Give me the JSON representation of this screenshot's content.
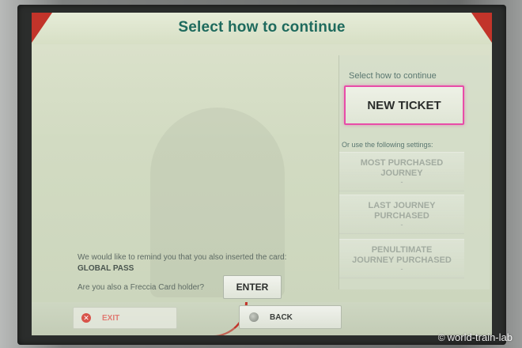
{
  "header": {
    "title": "Select how to continue"
  },
  "panel": {
    "heading": "Select how to continue",
    "new_ticket_label": "NEW TICKET",
    "subheading": "Or use the following settings:",
    "options": [
      {
        "line1": "MOST PURCHASED",
        "line2": "JOURNEY",
        "dot": "-"
      },
      {
        "line1": "LAST JOURNEY",
        "line2": "PURCHASED",
        "dot": "-"
      },
      {
        "line1": "PENULTIMATE",
        "line2": "JOURNEY PURCHASED",
        "dot": "-"
      }
    ]
  },
  "reminder": {
    "text": "We would like to remind you that you also inserted the card:",
    "card_name": "GLOBAL PASS",
    "question": "Are you also a Freccia Card holder?",
    "enter_label": "ENTER"
  },
  "bottom": {
    "exit_label": "EXIT",
    "back_label": "BACK"
  },
  "watermark": {
    "icon": "©",
    "text": "world-train-lab"
  },
  "colors": {
    "title": "#1e6a5d",
    "accent_red": "#c2342a",
    "highlight_pink": "#e84ca8"
  },
  "icons": {
    "exit": "exit-circle-icon",
    "back": "back-circle-icon"
  }
}
